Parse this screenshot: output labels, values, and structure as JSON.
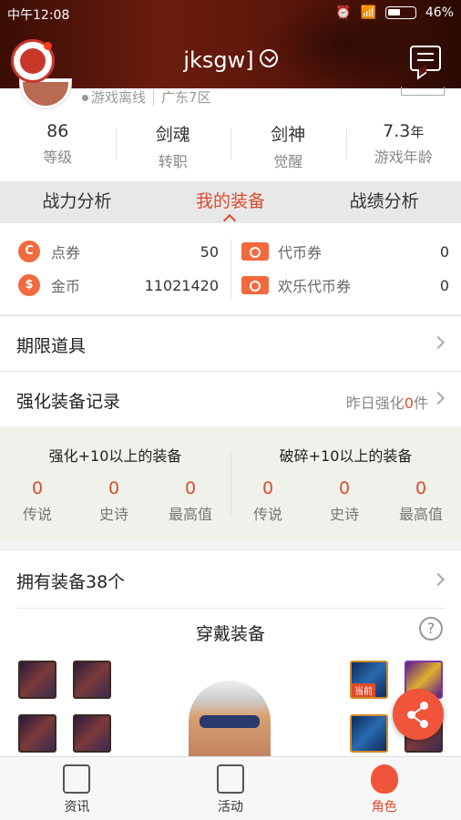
{
  "status_bar": {
    "time": "中午12:08",
    "battery": "46%"
  },
  "header": {
    "username": "jksgw]"
  },
  "profile": {
    "status": "游戏离线",
    "server": "广东7区",
    "stats": [
      {
        "value": "86",
        "unit": "",
        "label": "等级"
      },
      {
        "value": "剑魂",
        "unit": "",
        "label": "转职"
      },
      {
        "value": "剑神",
        "unit": "",
        "label": "觉醒"
      },
      {
        "value": "7.3",
        "unit": "年",
        "label": "游戏年龄"
      }
    ]
  },
  "tabs": [
    {
      "label": "战力分析",
      "active": false
    },
    {
      "label": "我的装备",
      "active": true
    },
    {
      "label": "战绩分析",
      "active": false
    }
  ],
  "wallet": {
    "dianquan": {
      "icon": "C",
      "label": "点券",
      "value": "50"
    },
    "jinbi": {
      "icon": "$",
      "label": "金币",
      "value": "11021420"
    },
    "daibi": {
      "label": "代币券",
      "value": "0"
    },
    "huanle": {
      "label": "欢乐代币券",
      "value": "0"
    }
  },
  "limited_items": {
    "label": "期限道具"
  },
  "enhance_record": {
    "label": "强化装备记录",
    "hint_prefix": "昨日强化",
    "hint_count": "0",
    "hint_suffix": "件"
  },
  "enhance_stats": {
    "strengthen": {
      "title": "强化+10以上的装备",
      "cells": [
        {
          "n": "0",
          "l": "传说"
        },
        {
          "n": "0",
          "l": "史诗"
        },
        {
          "n": "0",
          "l": "最高值"
        }
      ]
    },
    "break": {
      "title": "破碎+10以上的装备",
      "cells": [
        {
          "n": "0",
          "l": "传说"
        },
        {
          "n": "0",
          "l": "史诗"
        },
        {
          "n": "0",
          "l": "最高值"
        }
      ]
    }
  },
  "owned": {
    "label": "拥有装备38个",
    "worn_title": "穿戴装备",
    "help": "?",
    "current_tag": "当前"
  },
  "nav": [
    {
      "label": "资讯",
      "icon": "news-icon"
    },
    {
      "label": "活动",
      "icon": "activity-icon"
    },
    {
      "label": "角色",
      "icon": "character-icon"
    }
  ],
  "colors": {
    "accent": "#e04a2c",
    "header_dark": "#5c160a"
  }
}
